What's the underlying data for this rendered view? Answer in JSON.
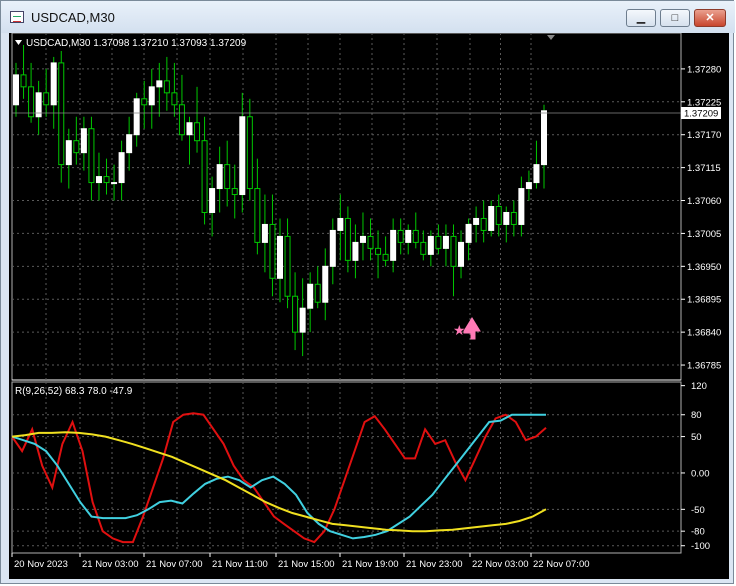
{
  "window": {
    "title": "USDCAD,M30",
    "minimize_glyph": "▁",
    "maximize_glyph": "□",
    "close_glyph": "✕"
  },
  "colors": {
    "background": "#000000",
    "grid": "#5a5a5a",
    "bull_candle": "#ffffff",
    "candle_wick": "#00c800",
    "cci_red": "#e01010",
    "cci_cyan": "#40d0e0",
    "cci_yellow": "#f0e020",
    "signal_arrow": "#ff7ab6"
  },
  "main_panel": {
    "info": "USDCAD,M30  1.37098 1.37210 1.37093 1.37209",
    "price_levels": [
      "1.37280",
      "1.37225",
      "1.37170",
      "1.37115",
      "1.37060",
      "1.37005",
      "1.36950",
      "1.36895",
      "1.36840",
      "1.36785"
    ],
    "current_price": "1.37209",
    "signal_icons": [
      "star-icon",
      "up-arrow-icon"
    ]
  },
  "sub_panel": {
    "info": "R(9,26,52) 68.3 78.0 -47.9",
    "levels": [
      "120",
      "80",
      "50",
      "0.00",
      "-50",
      "-80",
      "-100"
    ]
  },
  "time_axis": [
    "20 Nov 2023",
    "21 Nov 03:00",
    "21 Nov 07:00",
    "21 Nov 11:00",
    "21 Nov 15:00",
    "21 Nov 19:00",
    "21 Nov 23:00",
    "22 Nov 03:00",
    "22 Nov 07:00"
  ],
  "chart_data": [
    {
      "type": "candlestick",
      "title": "USDCAD,M30",
      "ohlc_readout": {
        "open": 1.37098,
        "high": 1.3721,
        "low": 1.37093,
        "close": 1.37209
      },
      "ylim": [
        1.3676,
        1.3734
      ],
      "candles": [
        [
          1.3722,
          1.3729,
          1.372,
          1.3727
        ],
        [
          1.3727,
          1.3732,
          1.3723,
          1.3725
        ],
        [
          1.3725,
          1.3729,
          1.3719,
          1.372
        ],
        [
          1.372,
          1.3726,
          1.3717,
          1.3724
        ],
        [
          1.3724,
          1.3728,
          1.372,
          1.3722
        ],
        [
          1.3722,
          1.373,
          1.3718,
          1.3729
        ],
        [
          1.3729,
          1.3731,
          1.3709,
          1.3712
        ],
        [
          1.3712,
          1.3718,
          1.3708,
          1.3716
        ],
        [
          1.3716,
          1.372,
          1.3712,
          1.3714
        ],
        [
          1.3714,
          1.372,
          1.3711,
          1.3718
        ],
        [
          1.3718,
          1.372,
          1.3706,
          1.3709
        ],
        [
          1.3709,
          1.3714,
          1.3706,
          1.371
        ],
        [
          1.371,
          1.3713,
          1.3707,
          1.3709
        ],
        [
          1.3709,
          1.3712,
          1.3706,
          1.3709
        ],
        [
          1.3709,
          1.3716,
          1.3706,
          1.3714
        ],
        [
          1.3714,
          1.372,
          1.3711,
          1.3717
        ],
        [
          1.3717,
          1.3724,
          1.3715,
          1.3723
        ],
        [
          1.3723,
          1.3726,
          1.3718,
          1.3722
        ],
        [
          1.3722,
          1.3728,
          1.3718,
          1.3725
        ],
        [
          1.3725,
          1.3729,
          1.372,
          1.3726
        ],
        [
          1.3726,
          1.373,
          1.3721,
          1.3724
        ],
        [
          1.3724,
          1.3729,
          1.372,
          1.3722
        ],
        [
          1.3722,
          1.3727,
          1.3716,
          1.3717
        ],
        [
          1.3717,
          1.372,
          1.3712,
          1.3719
        ],
        [
          1.3719,
          1.3725,
          1.3714,
          1.3716
        ],
        [
          1.3716,
          1.372,
          1.3702,
          1.3704
        ],
        [
          1.3704,
          1.371,
          1.37,
          1.3708
        ],
        [
          1.3708,
          1.3715,
          1.3704,
          1.3712
        ],
        [
          1.3712,
          1.3716,
          1.3705,
          1.3708
        ],
        [
          1.3708,
          1.3712,
          1.3703,
          1.3707
        ],
        [
          1.3707,
          1.3724,
          1.3704,
          1.372
        ],
        [
          1.372,
          1.3723,
          1.3706,
          1.3708
        ],
        [
          1.3708,
          1.3713,
          1.3697,
          1.3699
        ],
        [
          1.3699,
          1.3707,
          1.3694,
          1.3702
        ],
        [
          1.3702,
          1.3707,
          1.369,
          1.3693
        ],
        [
          1.3693,
          1.3703,
          1.3689,
          1.37
        ],
        [
          1.37,
          1.3703,
          1.3688,
          1.369
        ],
        [
          1.369,
          1.3694,
          1.3681,
          1.3684
        ],
        [
          1.3684,
          1.3693,
          1.368,
          1.3688
        ],
        [
          1.3688,
          1.3694,
          1.3684,
          1.3692
        ],
        [
          1.3692,
          1.3695,
          1.3688,
          1.3689
        ],
        [
          1.3689,
          1.3698,
          1.3686,
          1.3695
        ],
        [
          1.3695,
          1.3703,
          1.3692,
          1.3701
        ],
        [
          1.3701,
          1.3707,
          1.3696,
          1.3703
        ],
        [
          1.3703,
          1.3705,
          1.3694,
          1.3696
        ],
        [
          1.3696,
          1.3702,
          1.3693,
          1.3699
        ],
        [
          1.3699,
          1.3704,
          1.3696,
          1.37
        ],
        [
          1.37,
          1.3703,
          1.3696,
          1.3698
        ],
        [
          1.3698,
          1.3701,
          1.3693,
          1.3697
        ],
        [
          1.3697,
          1.37,
          1.3695,
          1.3696
        ],
        [
          1.3696,
          1.3703,
          1.3694,
          1.3701
        ],
        [
          1.3701,
          1.3703,
          1.3697,
          1.3699
        ],
        [
          1.3699,
          1.3702,
          1.3697,
          1.3701
        ],
        [
          1.3701,
          1.3704,
          1.3698,
          1.3699
        ],
        [
          1.3699,
          1.3701,
          1.3696,
          1.3697
        ],
        [
          1.3697,
          1.3701,
          1.3695,
          1.37
        ],
        [
          1.37,
          1.3702,
          1.3697,
          1.3698
        ],
        [
          1.3698,
          1.3702,
          1.3695,
          1.37
        ],
        [
          1.37,
          1.3702,
          1.369,
          1.3695
        ],
        [
          1.3695,
          1.3701,
          1.3693,
          1.3699
        ],
        [
          1.3699,
          1.3703,
          1.3696,
          1.3702
        ],
        [
          1.3702,
          1.3705,
          1.3699,
          1.3703
        ],
        [
          1.3703,
          1.3706,
          1.3699,
          1.3701
        ],
        [
          1.3701,
          1.3706,
          1.37,
          1.3705
        ],
        [
          1.3705,
          1.3707,
          1.37,
          1.3702
        ],
        [
          1.3702,
          1.3705,
          1.3699,
          1.3704
        ],
        [
          1.3704,
          1.3706,
          1.37,
          1.3702
        ],
        [
          1.3702,
          1.371,
          1.37,
          1.3708
        ],
        [
          1.3708,
          1.3711,
          1.3706,
          1.3709
        ],
        [
          1.3709,
          1.3716,
          1.3708,
          1.3712
        ],
        [
          1.3712,
          1.3722,
          1.3708,
          1.3721
        ]
      ]
    },
    {
      "type": "line",
      "title": "R(9,26,52)",
      "readout": [
        68.3,
        78.0,
        -47.9
      ],
      "ylim": [
        -110,
        125
      ],
      "yticks": [
        120,
        80,
        50,
        0,
        -50,
        -80,
        -100
      ],
      "series": [
        {
          "color": "#e01010",
          "values": [
            50,
            30,
            60,
            10,
            -20,
            40,
            70,
            30,
            -40,
            -80,
            -90,
            -95,
            -95,
            -60,
            -20,
            20,
            70,
            80,
            82,
            80,
            60,
            40,
            10,
            -10,
            -20,
            -40,
            -60,
            -70,
            -80,
            -90,
            -95,
            -80,
            -50,
            -10,
            30,
            70,
            78,
            60,
            40,
            20,
            20,
            60,
            40,
            45,
            15,
            -10,
            20,
            50,
            75,
            80,
            70,
            45,
            50,
            62
          ]
        },
        {
          "color": "#40d0e0",
          "values": [
            50,
            45,
            40,
            30,
            10,
            -15,
            -40,
            -60,
            -62,
            -62,
            -62,
            -58,
            -50,
            -40,
            -38,
            -42,
            -28,
            -15,
            -8,
            -5,
            -10,
            -20,
            -10,
            -5,
            -15,
            -30,
            -55,
            -70,
            -80,
            -85,
            -90,
            -88,
            -85,
            -80,
            -70,
            -60,
            -45,
            -30,
            -10,
            10,
            30,
            50,
            70,
            72,
            80,
            80,
            80,
            80
          ]
        },
        {
          "color": "#f0e020",
          "values": [
            50,
            52,
            55,
            55,
            56,
            55,
            53,
            50,
            45,
            40,
            34,
            28,
            22,
            14,
            6,
            -2,
            -10,
            -20,
            -30,
            -40,
            -48,
            -55,
            -60,
            -65,
            -70,
            -72,
            -74,
            -76,
            -78,
            -79,
            -80,
            -80,
            -79,
            -78,
            -76,
            -74,
            -72,
            -70,
            -66,
            -60,
            -50
          ]
        }
      ]
    }
  ]
}
